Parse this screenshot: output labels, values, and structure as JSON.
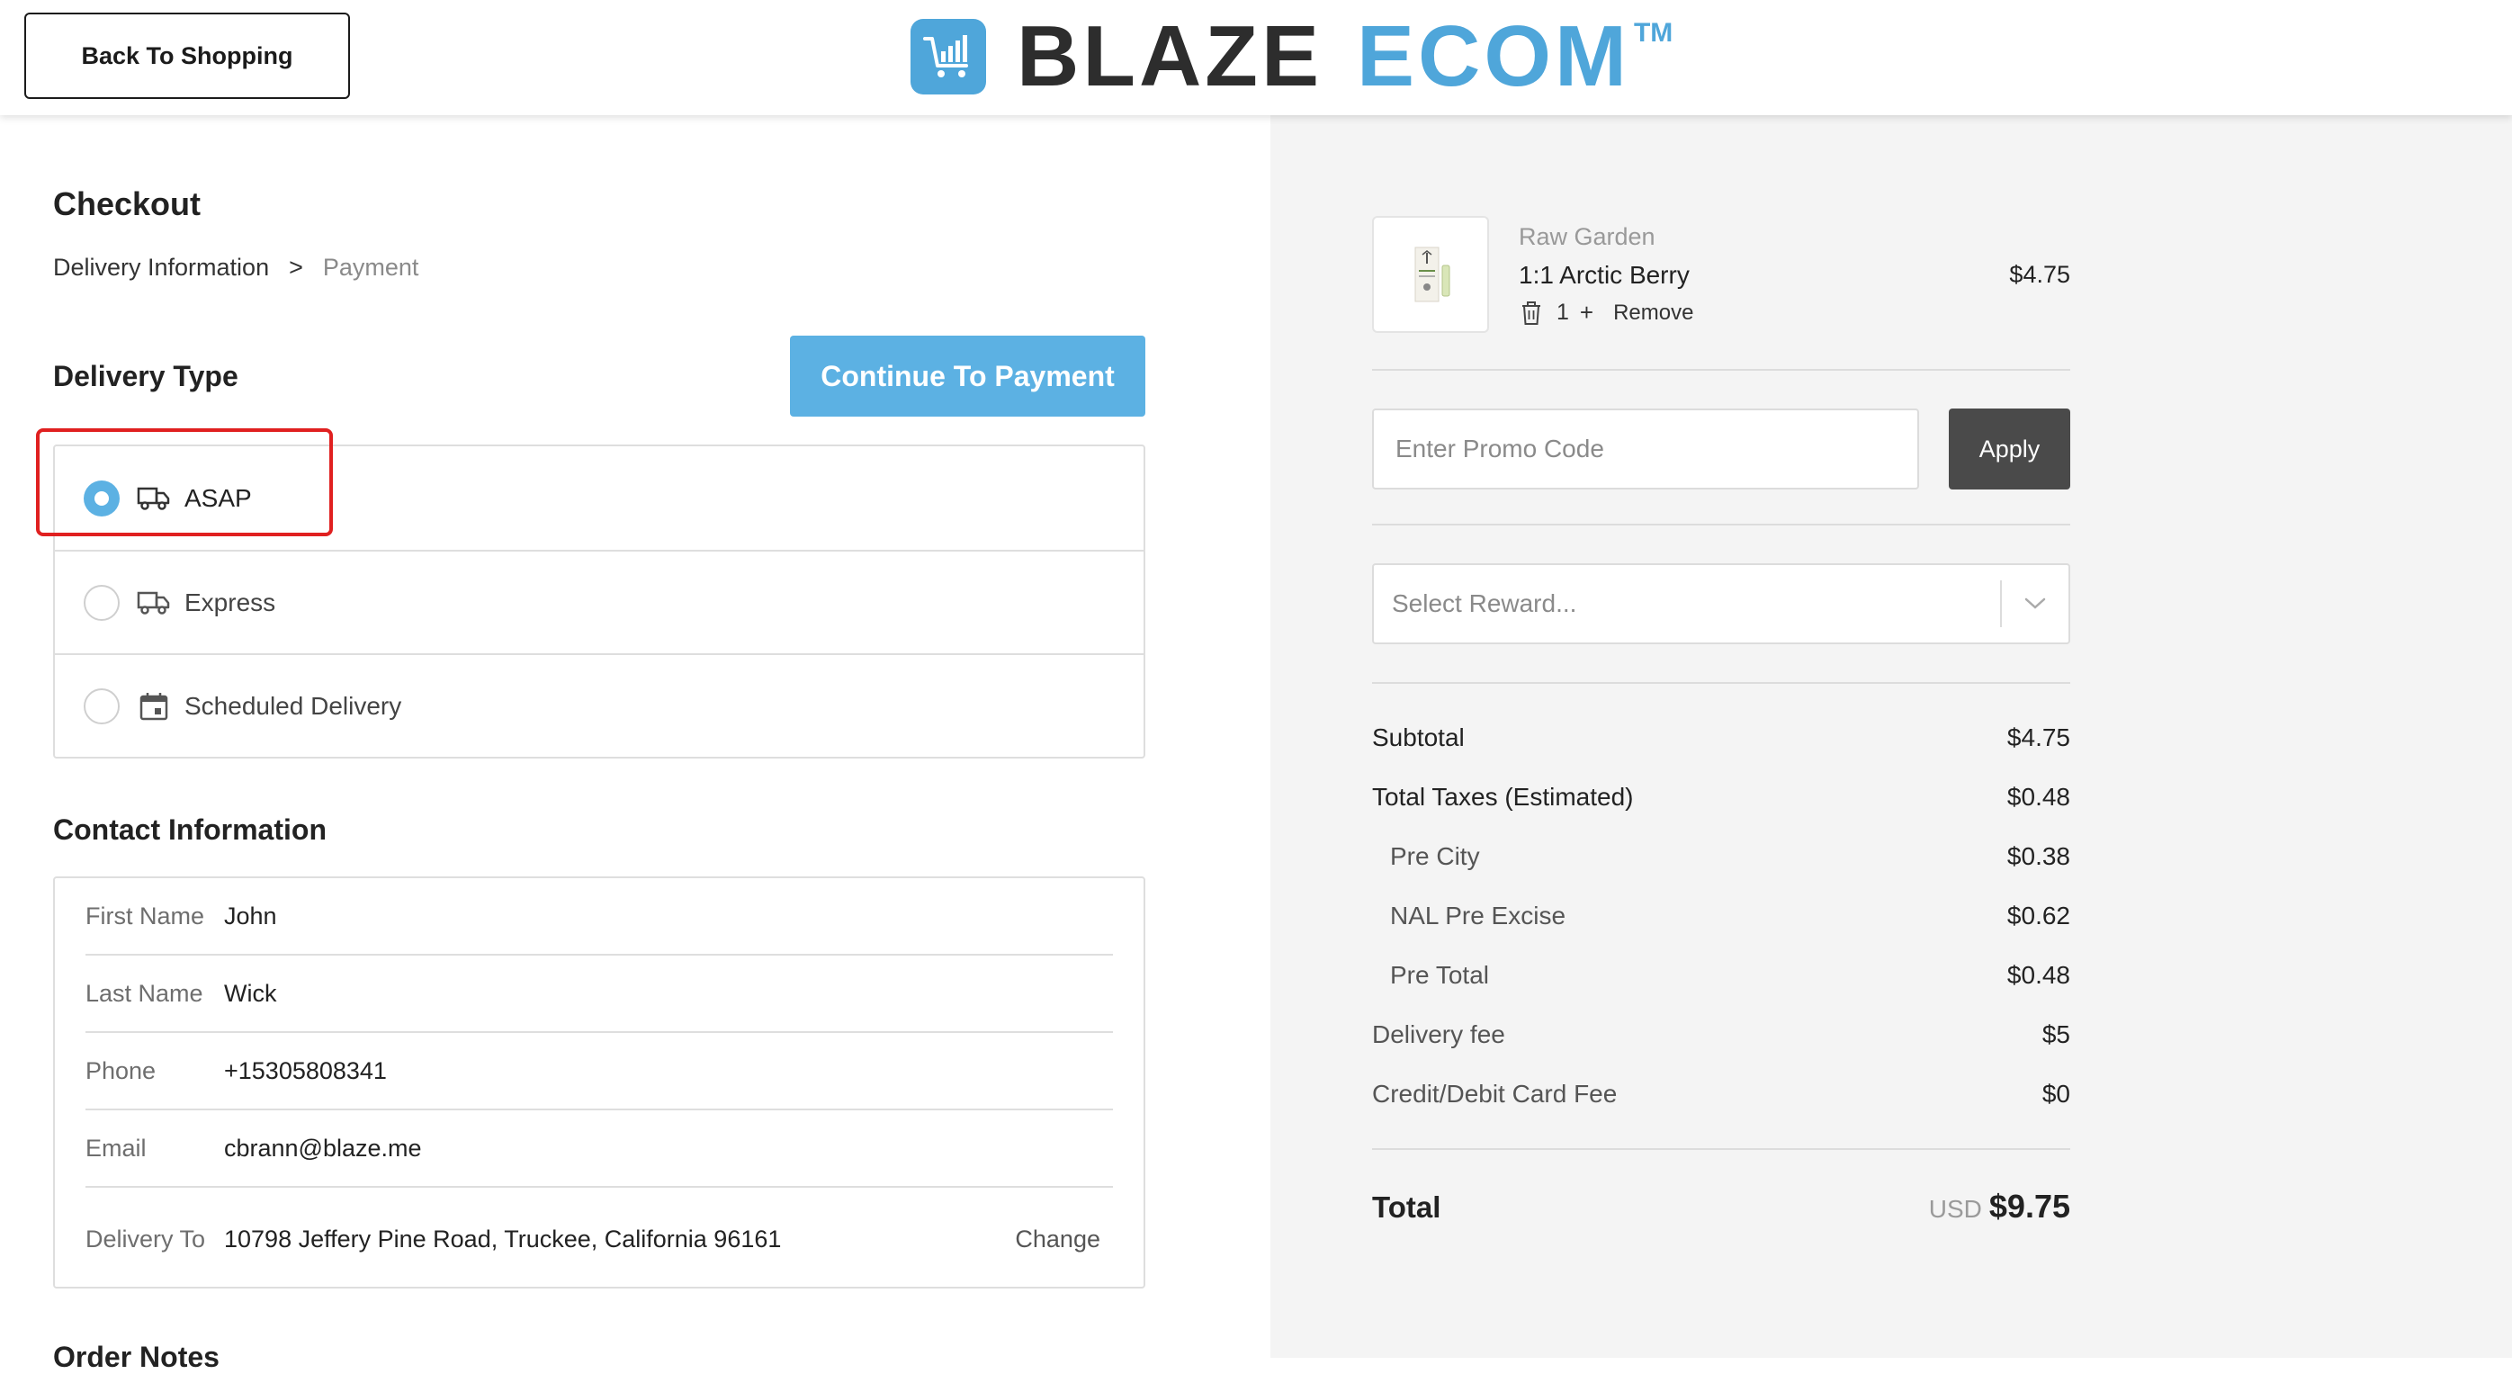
{
  "header": {
    "back_label": "Back To Shopping",
    "brand_word1": "BLAZE",
    "brand_word2": "ECOM",
    "brand_tm": "TM",
    "brand_color": "#4fa6da"
  },
  "checkout": {
    "title": "Checkout",
    "breadcrumb": {
      "step1": "Delivery Information",
      "separator": ">",
      "step2": "Payment"
    },
    "delivery_type_title": "Delivery Type",
    "continue_label": "Continue To Payment",
    "delivery_options": [
      {
        "label": "ASAP",
        "icon": "truck-icon",
        "selected": true
      },
      {
        "label": "Express",
        "icon": "truck-icon",
        "selected": false
      },
      {
        "label": "Scheduled Delivery",
        "icon": "calendar-icon",
        "selected": false
      }
    ],
    "contact_title": "Contact Information",
    "contact": {
      "first_name": {
        "label": "First Name",
        "value": "John"
      },
      "last_name": {
        "label": "Last Name",
        "value": "Wick"
      },
      "phone": {
        "label": "Phone",
        "value": "+15305808341"
      },
      "email": {
        "label": "Email",
        "value": "cbrann@blaze.me"
      },
      "delivery_to": {
        "label": "Delivery To",
        "value": "10798 Jeffery Pine Road, Truckee, California 96161",
        "action": "Change"
      }
    },
    "order_notes_title": "Order Notes"
  },
  "cart": {
    "item": {
      "brand": "Raw Garden",
      "name": "1:1 Arctic Berry",
      "price": "$4.75",
      "qty": "1",
      "plus": "+",
      "remove_label": "Remove"
    },
    "promo": {
      "placeholder": "Enter Promo Code",
      "apply_label": "Apply"
    },
    "reward": {
      "placeholder": "Select Reward..."
    },
    "summary": {
      "subtotal": {
        "label": "Subtotal",
        "value": "$4.75"
      },
      "taxes": {
        "label": "Total Taxes (Estimated)",
        "value": "$0.48"
      },
      "pre_city": {
        "label": "Pre City",
        "value": "$0.38"
      },
      "nal_pre_excise": {
        "label": "NAL Pre Excise",
        "value": "$0.62"
      },
      "pre_total": {
        "label": "Pre Total",
        "value": "$0.48"
      },
      "delivery_fee": {
        "label": "Delivery fee",
        "value": "$5"
      },
      "card_fee": {
        "label": "Credit/Debit Card Fee",
        "value": "$0"
      }
    },
    "total": {
      "label": "Total",
      "currency": "USD",
      "value": "$9.75"
    }
  },
  "colors": {
    "accent": "#5cb1e3",
    "highlight": "#e02020",
    "panel_bg": "#f4f4f4",
    "apply_bg": "#4a4a4a"
  }
}
